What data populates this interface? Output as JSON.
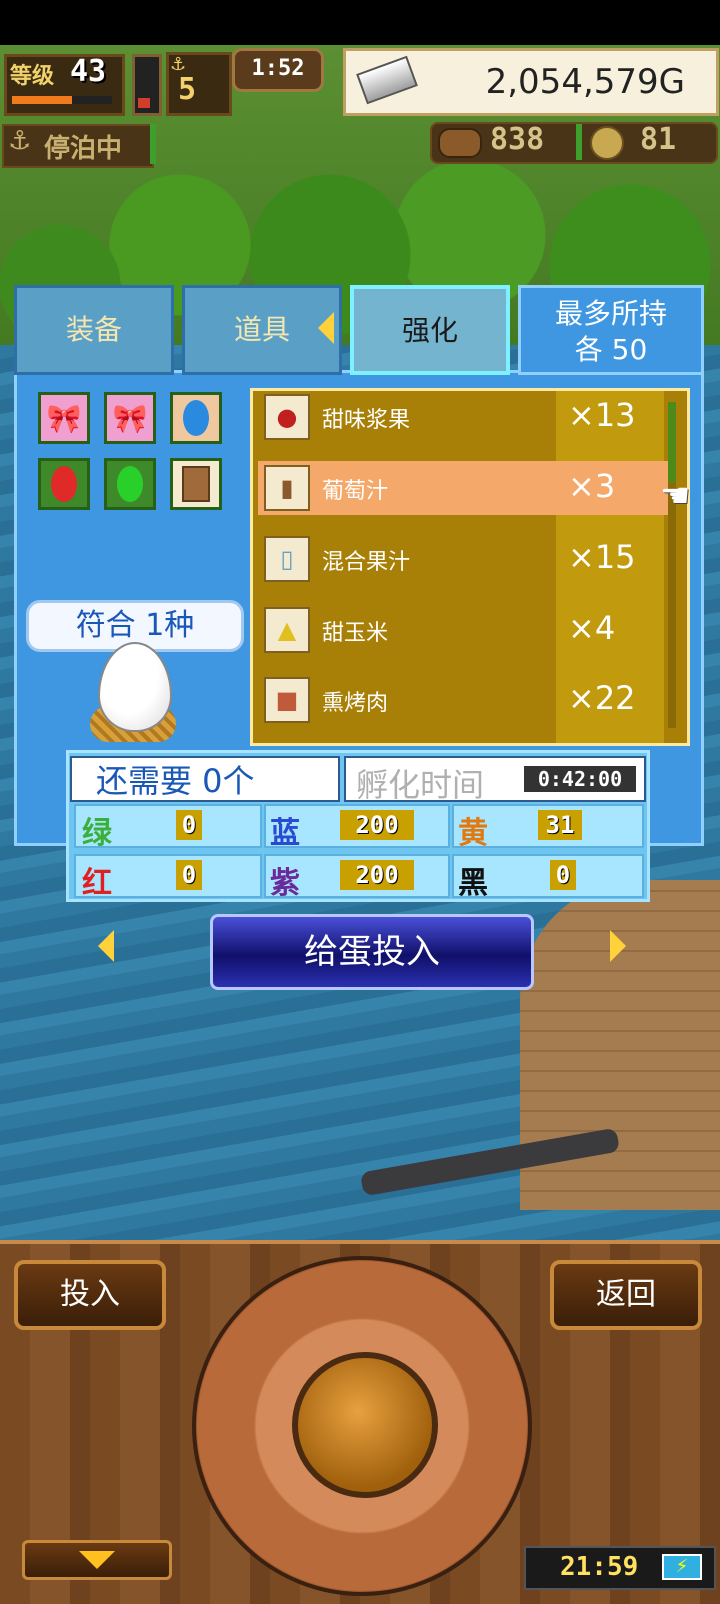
{
  "hud": {
    "level_label": "等级",
    "level": "43",
    "level_progress": 0.6,
    "ships": "5",
    "clock": "1:52",
    "gold": "2,054,579G",
    "dock_status": "停泊中",
    "wood": "838",
    "coins": "81"
  },
  "tabs": {
    "equip": "装备",
    "items": "道具",
    "enhance": "强化",
    "max_line1": "最多所持",
    "max_line2": "各 50"
  },
  "egg": {
    "match": "符合 1种",
    "need": "还需要 0个",
    "hatch_label": "孵化时间",
    "hatch_time": "0:42:00"
  },
  "stats": [
    {
      "label": "绿",
      "value": "0",
      "color": "#3ab03a"
    },
    {
      "label": "蓝",
      "value": "200",
      "color": "#2a4ad0"
    },
    {
      "label": "黄",
      "value": "31",
      "color": "#e07a10"
    },
    {
      "label": "红",
      "value": "0",
      "color": "#e02020"
    },
    {
      "label": "紫",
      "value": "200",
      "color": "#6a2a9a"
    },
    {
      "label": "黑",
      "value": "0",
      "color": "#111111"
    }
  ],
  "items": [
    {
      "name": "甜味浆果",
      "qty": "×13",
      "icon": "berry-icon"
    },
    {
      "name": "葡萄汁",
      "qty": "×3",
      "icon": "mug-icon",
      "selected": true
    },
    {
      "name": "混合果汁",
      "qty": "×15",
      "icon": "bottle-icon"
    },
    {
      "name": "甜玉米",
      "qty": "×4",
      "icon": "corn-icon"
    },
    {
      "name": "熏烤肉",
      "qty": "×22",
      "icon": "meat-icon"
    }
  ],
  "buttons": {
    "invest_egg": "给蛋投入",
    "invest": "投入",
    "back": "返回"
  },
  "status_time": "21:59"
}
